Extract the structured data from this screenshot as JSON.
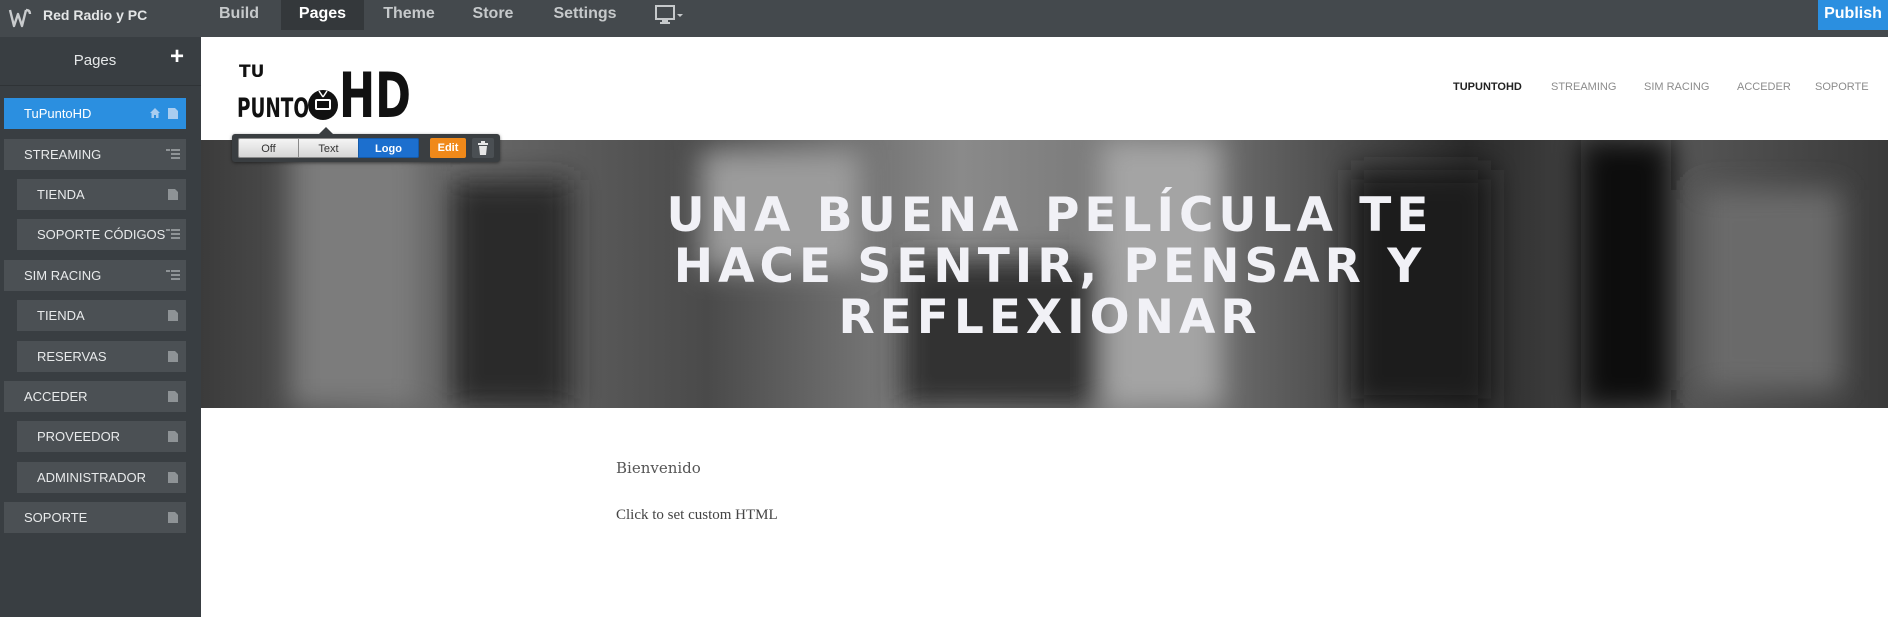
{
  "topbar": {
    "site_name": "Red Radio y PC",
    "tabs": [
      {
        "label": "Build"
      },
      {
        "label": "Pages"
      },
      {
        "label": "Theme"
      },
      {
        "label": "Store"
      },
      {
        "label": "Settings"
      }
    ],
    "active_tab": "Pages",
    "device_icon": "desktop-icon",
    "publish_label": "Publish",
    "colors": {
      "bar": "#44494d",
      "active_tab": "#34383b",
      "publish": "#2b8fe0"
    }
  },
  "sidebar": {
    "title": "Pages",
    "add_icon": "plus-icon",
    "items": [
      {
        "label": "TuPuntoHD",
        "active": true,
        "icons": [
          "home-icon",
          "page-icon"
        ]
      },
      {
        "label": "STREAMING",
        "icons": [
          "submenu-icon"
        ]
      },
      {
        "label": "TIENDA",
        "icons": [
          "page-icon"
        ]
      },
      {
        "label": "SOPORTE CÓDIGOS",
        "icons": [
          "submenu-icon"
        ]
      },
      {
        "label": "SIM RACING",
        "icons": [
          "submenu-icon"
        ]
      },
      {
        "label": "TIENDA",
        "icons": [
          "page-icon"
        ]
      },
      {
        "label": "RESERVAS",
        "icons": [
          "page-icon"
        ]
      },
      {
        "label": "ACCEDER",
        "icons": [
          "page-icon"
        ]
      },
      {
        "label": "PROVEEDOR",
        "icons": [
          "page-icon"
        ]
      },
      {
        "label": "ADMINISTRADOR",
        "icons": [
          "page-icon"
        ]
      },
      {
        "label": "SOPORTE",
        "icons": [
          "page-icon"
        ]
      }
    ]
  },
  "site": {
    "logo_text": {
      "line1": "TU",
      "line2": "PUNTO",
      "line3": "HD"
    },
    "nav": [
      "TUPUNTOHD",
      "STREAMING",
      "SIM RACING",
      "ACCEDER",
      "SOPORTE"
    ],
    "logo_toolbar": {
      "options": [
        "Off",
        "Text",
        "Logo"
      ],
      "selected": "Logo",
      "edit_label": "Edit",
      "delete_icon": "trash-icon"
    },
    "banner_heading": "UNA BUENA PELÍCULA TE HACE SENTIR, PENSAR Y REFLEXIONAR",
    "welcome": "Bienvenido",
    "custom_html": "Click to set custom HTML"
  }
}
